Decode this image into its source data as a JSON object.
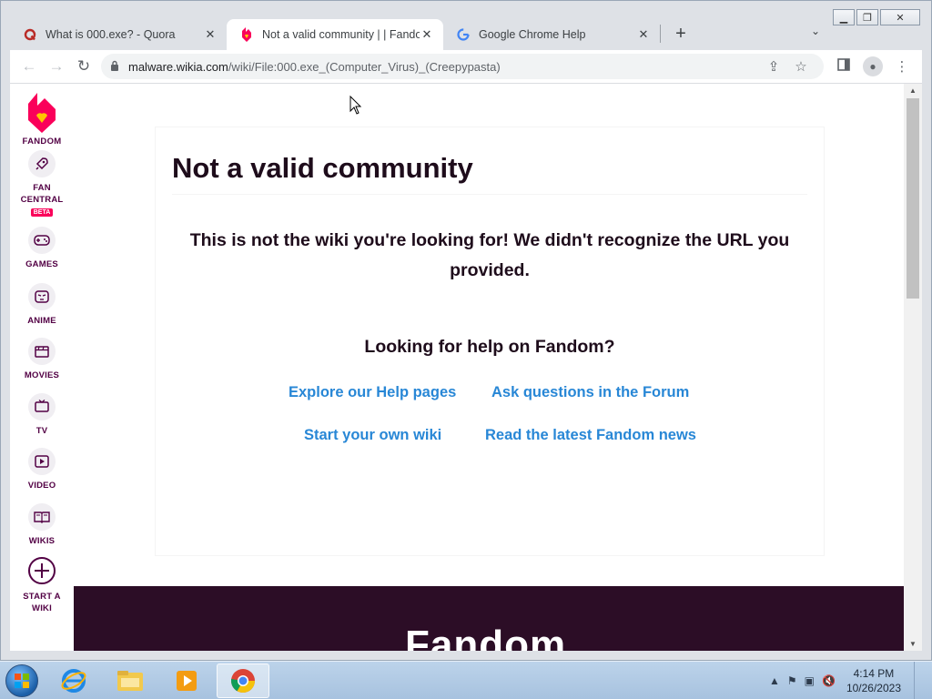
{
  "browser": {
    "tabs": [
      {
        "title": "What is 000.exe? - Quora",
        "favicon": "quora-icon",
        "active": false
      },
      {
        "title": "Not a valid community | | Fandom",
        "favicon": "fandom-icon",
        "active": true
      },
      {
        "title": "Google Chrome Help",
        "favicon": "google-icon",
        "active": false
      }
    ],
    "url_host": "malware.wikia.com",
    "url_path": "/wiki/File:000.exe_(Computer_Virus)_(Creepypasta)"
  },
  "fandom_sidebar": {
    "brand": "FANDOM",
    "items": [
      {
        "label": "FAN CENTRAL",
        "icon": "rocket-icon",
        "badge": "BETA"
      },
      {
        "label": "GAMES",
        "icon": "gamepad-icon"
      },
      {
        "label": "ANIME",
        "icon": "anime-face-icon"
      },
      {
        "label": "MOVIES",
        "icon": "clapperboard-icon"
      },
      {
        "label": "TV",
        "icon": "tv-icon"
      },
      {
        "label": "VIDEO",
        "icon": "play-icon"
      },
      {
        "label": "WIKIS",
        "icon": "book-icon"
      },
      {
        "label": "START A WIKI",
        "icon": "plus-circle-icon"
      }
    ]
  },
  "page": {
    "heading": "Not a valid community",
    "message": "This is not the wiki you're looking for! We didn't recognize the URL you provided.",
    "help_heading": "Looking for help on Fandom?",
    "links": {
      "help_pages": "Explore our Help pages",
      "forum": "Ask questions in the Forum",
      "start_wiki": "Start your own wiki",
      "news": "Read the latest Fandom news"
    },
    "footer_logo": "Fandom"
  },
  "taskbar": {
    "time": "4:14 PM",
    "date": "10/26/2023"
  },
  "colors": {
    "fandom_brand": "#fa005a",
    "fandom_dark": "#520044",
    "link": "#2887d6",
    "footer": "#2c0d26"
  }
}
